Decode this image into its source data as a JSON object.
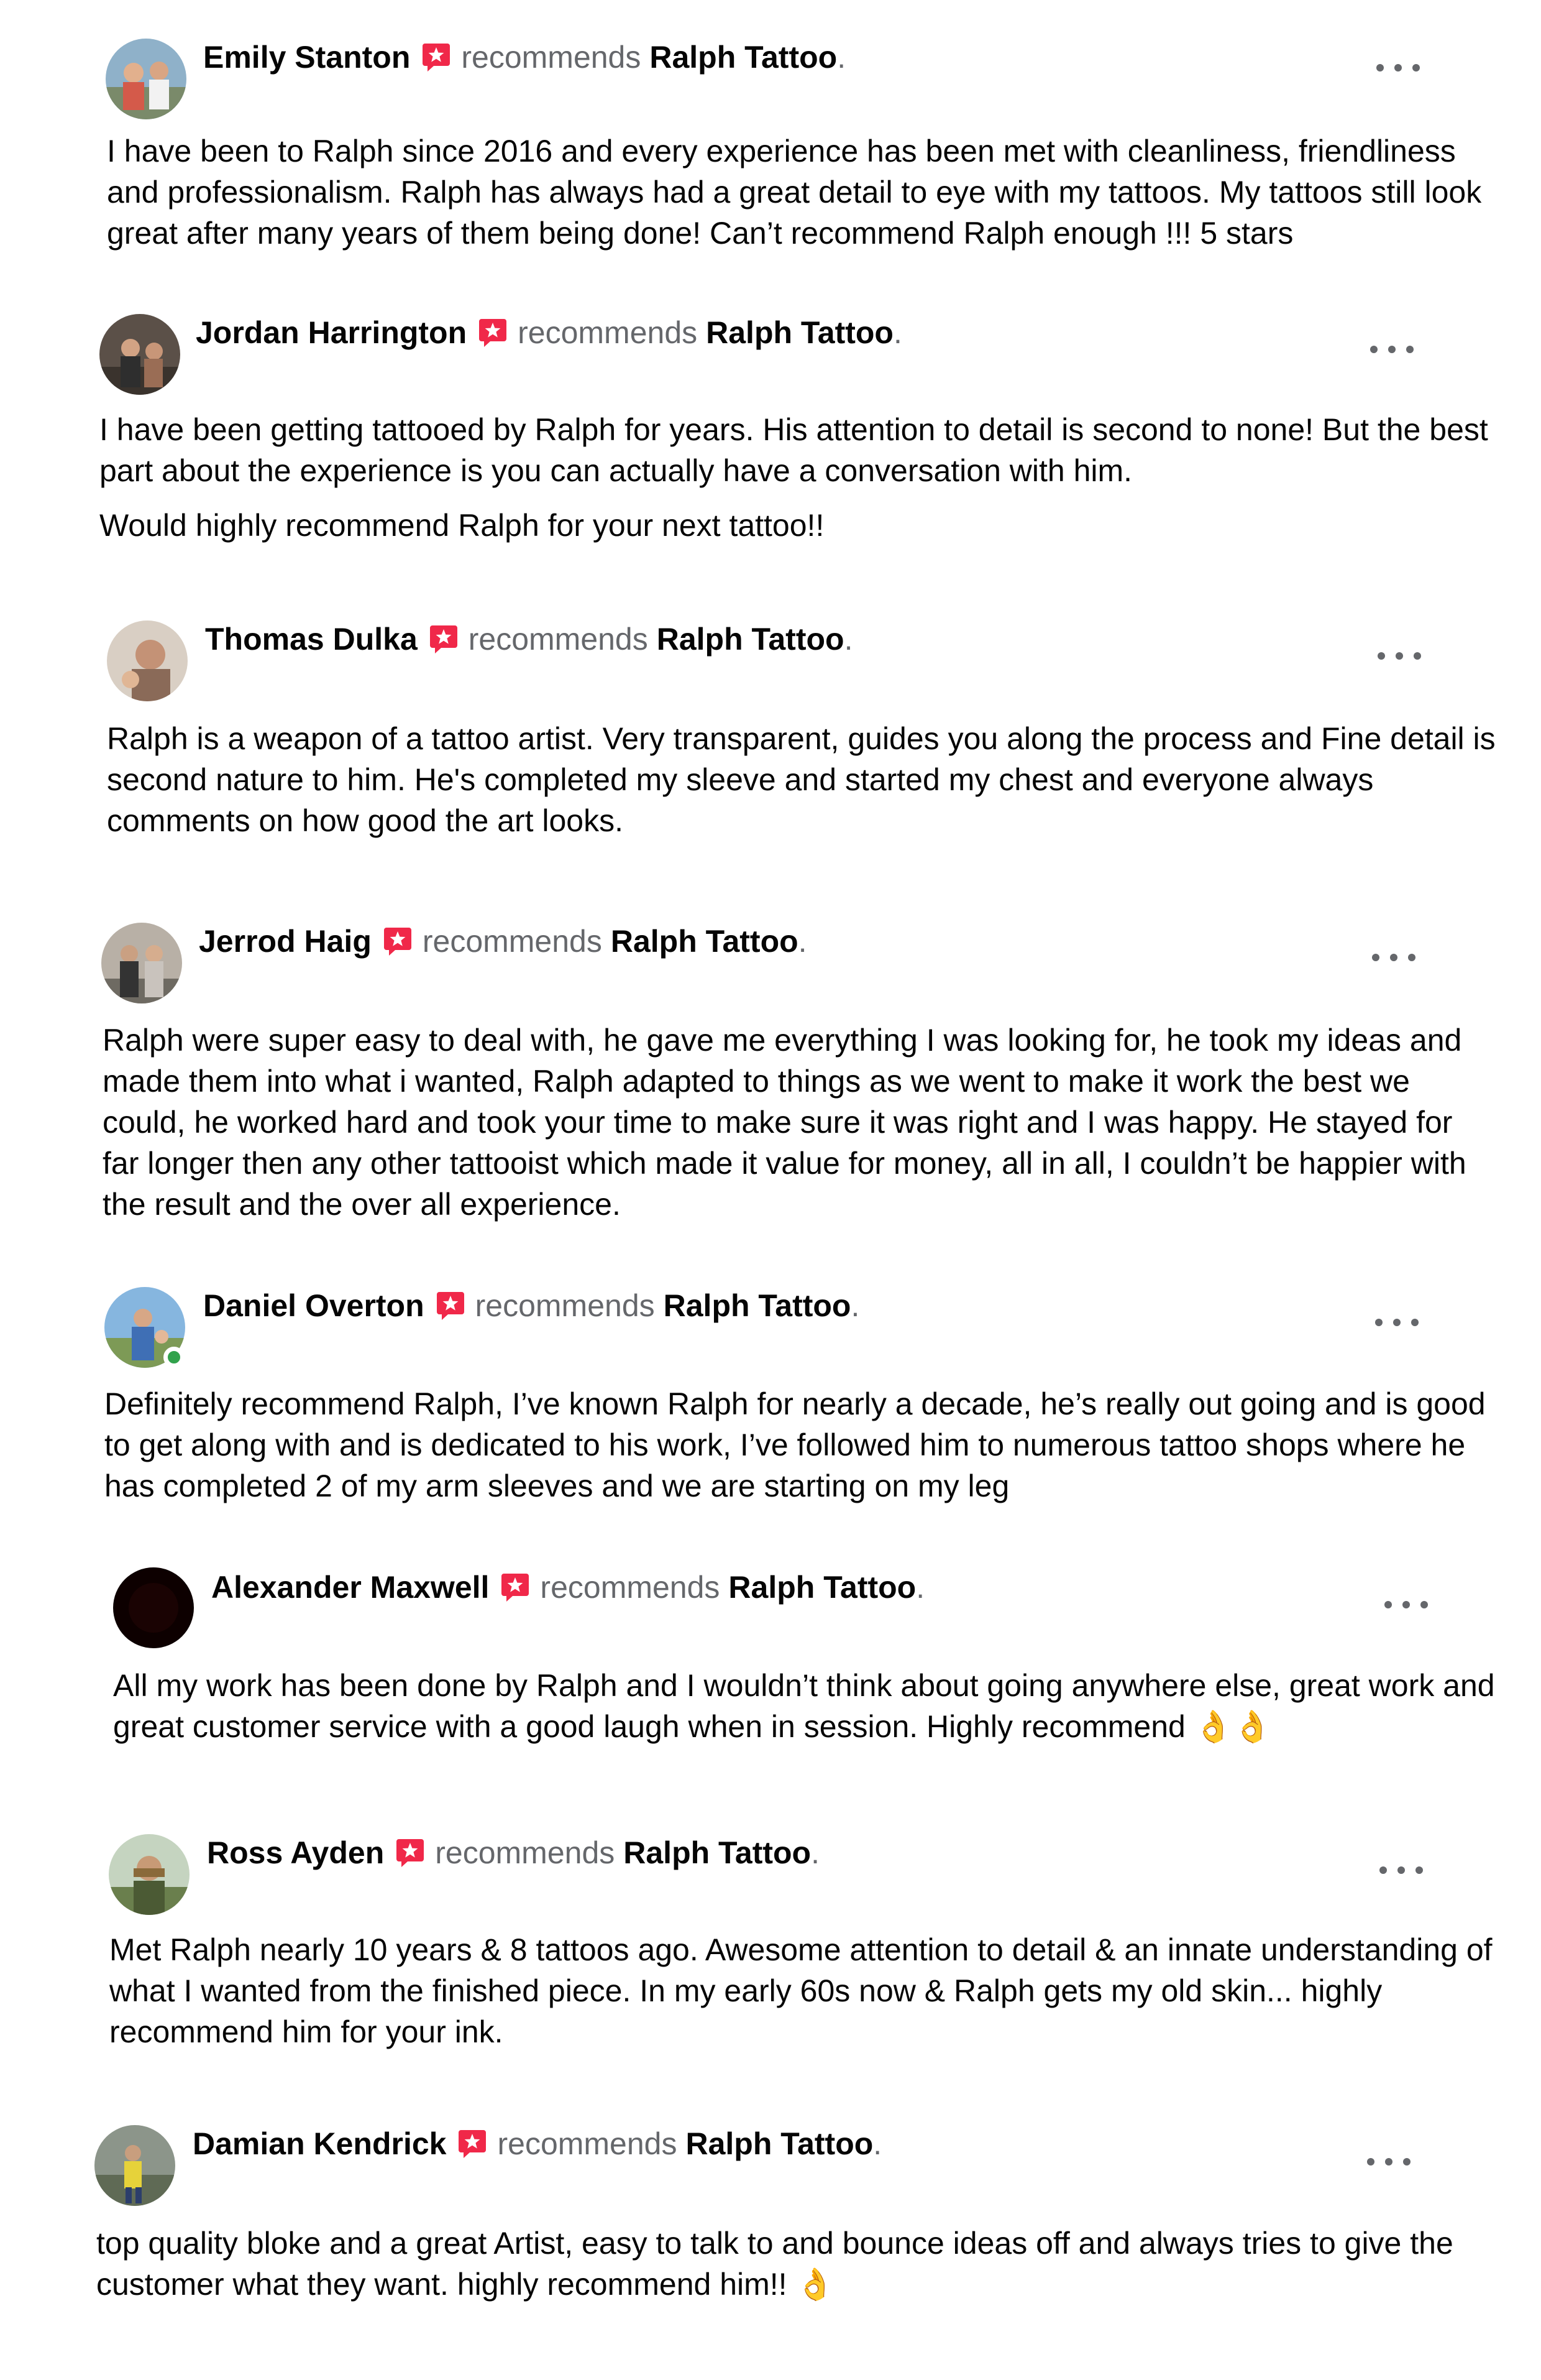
{
  "common": {
    "recommends_label": "recommends",
    "page_name": "Ralph Tattoo",
    "period": "."
  },
  "colors": {
    "recommend_badge": "#f02849",
    "secondary_text": "#65676b",
    "online_status": "#31a24c"
  },
  "reviews": [
    {
      "author": "Emily Stanton",
      "paragraphs": [
        "I have been to Ralph since 2016 and every experience has been met with cleanliness, friendliness and professionalism. Ralph has always had a great detail to eye with my tattoos. My tattoos still look great after many years of them being done! Can’t recommend Ralph enough !!! 5 stars"
      ]
    },
    {
      "author": "Jordan Harrington",
      "paragraphs": [
        "I have been getting tattooed by Ralph for years. His attention to detail is second to none! But the best part about the experience is you can actually have a conversation with him.",
        "Would highly recommend Ralph for your next tattoo!!"
      ]
    },
    {
      "author": "Thomas Dulka",
      "paragraphs": [
        "Ralph is a weapon of a tattoo artist. Very transparent, guides you along the process and Fine detail is second nature to him. He's completed my sleeve and started my chest and everyone always comments on how good the art looks."
      ]
    },
    {
      "author": "Jerrod Haig",
      "paragraphs": [
        "Ralph were super easy to deal with, he gave me everything I was looking for, he took my ideas and made them into what i wanted, Ralph adapted to things as we went to make it work the best we could, he worked hard and took your time to make sure it was right and I was happy. He stayed for far longer then any other tattooist which made it value for money, all in all, I couldn’t be happier with the result and the over all experience."
      ]
    },
    {
      "author": "Daniel Overton",
      "online": true,
      "paragraphs": [
        "Definitely recommend Ralph, I’ve known Ralph for nearly a decade, he’s really out going and is good to get along with and is dedicated to his work, I’ve followed him to numerous tattoo shops where he has completed 2 of my arm sleeves and we are starting on my leg"
      ]
    },
    {
      "author": "Alexander Maxwell",
      "paragraphs": [
        "All my work has been done by Ralph and I wouldn’t think about going anywhere else, great work and great customer service with a good laugh when in session. Highly recommend 👌👌"
      ]
    },
    {
      "author": "Ross Ayden",
      "paragraphs": [
        "Met Ralph nearly 10 years & 8 tattoos ago. Awesome attention to detail & an innate understanding of what I wanted from the finished piece. In my early 60s now & Ralph gets my old skin... highly recommend him for your ink."
      ]
    },
    {
      "author": "Damian Kendrick",
      "paragraphs": [
        "top quality bloke and a great Artist, easy to talk to and bounce ideas off and always tries to give the customer what they want. highly recommend him!! 👌"
      ]
    }
  ]
}
